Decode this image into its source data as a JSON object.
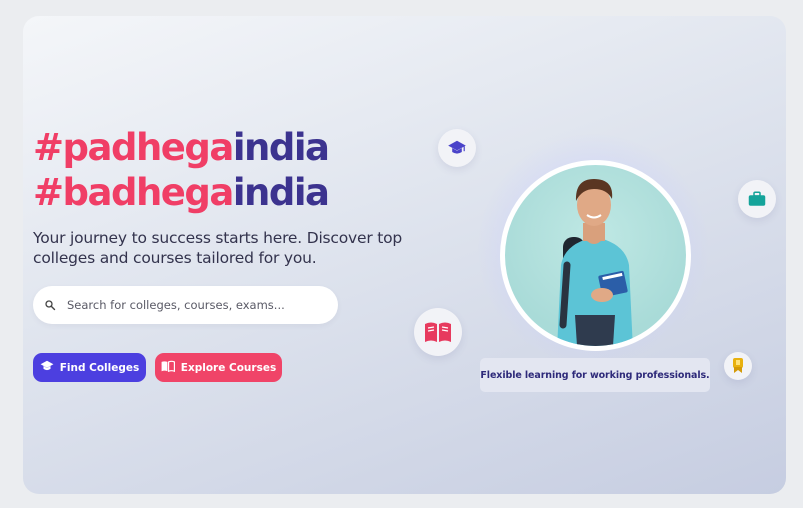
{
  "hero": {
    "line1_hash": "#padhega",
    "line1_word": "india",
    "line2_hash": "#badhega",
    "line2_word": "india",
    "subtitle": "Your journey to success starts here. Discover top colleges and courses tailored for you."
  },
  "search": {
    "placeholder": "Search for colleges, courses, exams...",
    "value": ""
  },
  "buttons": {
    "find_colleges": "Find Colleges",
    "explore_courses": "Explore Courses"
  },
  "caption": "Flexible learning for working professionals.",
  "icons": {
    "graduation": "graduation-cap-icon",
    "briefcase": "briefcase-icon",
    "book": "open-book-icon",
    "award": "award-ribbon-icon",
    "search": "search-icon"
  },
  "colors": {
    "accent_pink": "#f03e66",
    "accent_navy": "#3c338f",
    "button_blue": "#4c3fe0",
    "button_pink": "#f04468"
  }
}
